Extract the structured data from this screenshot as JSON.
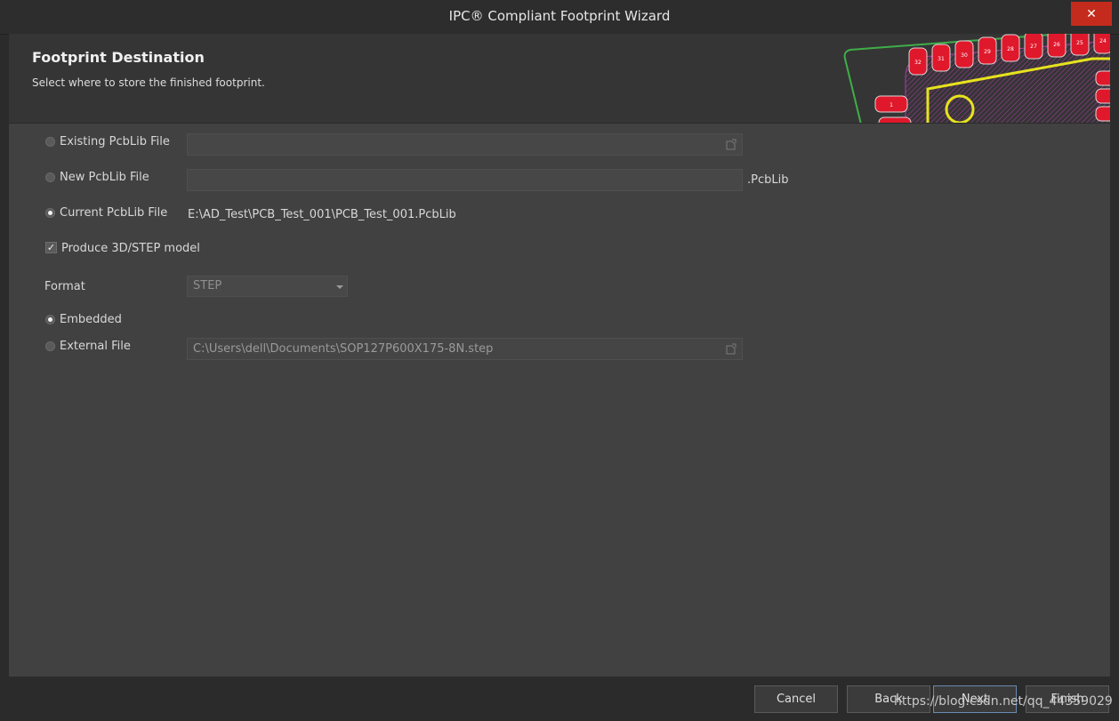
{
  "window": {
    "title": "IPC® Compliant Footprint Wizard",
    "close_glyph": "✕"
  },
  "header": {
    "title": "Footprint Destination",
    "subtitle": "Select where to store the finished footprint."
  },
  "pcb_art": {
    "pad_labels": [
      "32",
      "31",
      "30",
      "29",
      "28",
      "27",
      "26",
      "25",
      "24",
      "1"
    ]
  },
  "options": {
    "existing": {
      "label": "Existing PcbLib File",
      "value": "",
      "selected": false
    },
    "new": {
      "label": "New PcbLib File",
      "value": "",
      "suffix": ".PcbLib",
      "selected": false
    },
    "current": {
      "label": "Current PcbLib File",
      "value": "E:\\AD_Test\\PCB_Test_001\\PCB_Test_001.PcbLib",
      "selected": true
    }
  },
  "model": {
    "produce_label": "Produce 3D/STEP model",
    "produce_checked": true,
    "format_label": "Format",
    "format_value": "STEP",
    "embedded_label": "Embedded",
    "embedded_selected": true,
    "external_label": "External File",
    "external_path": "C:\\Users\\dell\\Documents\\SOP127P600X175-8N.step"
  },
  "footer": {
    "cancel": "Cancel",
    "back": "Back",
    "next": "Next",
    "finish": "Finish"
  },
  "watermark": "https://blog.csdn.net/qq_44359029",
  "colors": {
    "close_bg": "#c42b1c",
    "pad_red": "#e0182b",
    "board_outline": "#3fae49",
    "silk_yellow": "#e6e31e",
    "trace_magenta": "#b03aa8"
  }
}
